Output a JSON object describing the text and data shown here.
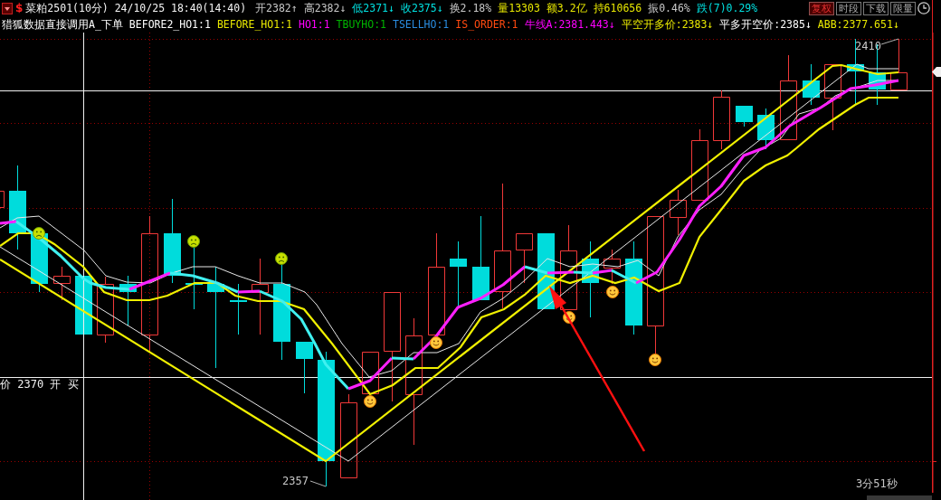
{
  "quote_bar": {
    "symbol_mark": "$",
    "title": "菜粕2501(10分) 24/10/25 18:40(14:40)",
    "fields": [
      {
        "text": "开2382↑",
        "color": "#c8c8c8"
      },
      {
        "text": "高2382↓",
        "color": "#c8c8c8"
      },
      {
        "text": "低2371↓",
        "color": "#00e0e0"
      },
      {
        "text": "收2375↓",
        "color": "#00e0e0"
      },
      {
        "text": "换2.18%",
        "color": "#c8c8c8"
      },
      {
        "text": "量13303",
        "color": "#e8e800"
      },
      {
        "text": "额3.2亿",
        "color": "#e8e800"
      },
      {
        "text": "持610656",
        "color": "#e8e800"
      },
      {
        "text": "振0.46%",
        "color": "#c8c8c8"
      },
      {
        "text": "跌(7)0.29%",
        "color": "#00e0e0"
      }
    ]
  },
  "toolbar": {
    "buttons": [
      {
        "label": "复权",
        "selected": true
      },
      {
        "label": "时段",
        "selected": false
      },
      {
        "label": "下载",
        "selected": false
      },
      {
        "label": "限量",
        "selected": false
      }
    ]
  },
  "indicator_bar": {
    "items": [
      {
        "text": "猎狐数据直接调用A_下单",
        "color": "#ffffff"
      },
      {
        "text": "BEFORE2_HO1:1",
        "color": "#ffffff"
      },
      {
        "text": "BEFORE_HO1:1",
        "color": "#e8e800"
      },
      {
        "text": "HO1:1",
        "color": "#ff00ff"
      },
      {
        "text": "TBUYHO:1",
        "color": "#00b400"
      },
      {
        "text": "TSELLHO:1",
        "color": "#2a8ce0"
      },
      {
        "text": "IS_ORDER:1",
        "color": "#ff4a10"
      },
      {
        "text": "牛线A:2381.443↓",
        "color": "#ff00ff"
      },
      {
        "text": "平空开多价:2383↓",
        "color": "#e8e800"
      },
      {
        "text": "平多开空价:2385↓",
        "color": "#ffffff"
      },
      {
        "text": "ABB:2377.651↓",
        "color": "#e8e800"
      }
    ]
  },
  "chart": {
    "high_label": "2410",
    "low_label": "2357",
    "price_line_label": "价 2370 开 买",
    "countdown": "3分51秒"
  }
}
